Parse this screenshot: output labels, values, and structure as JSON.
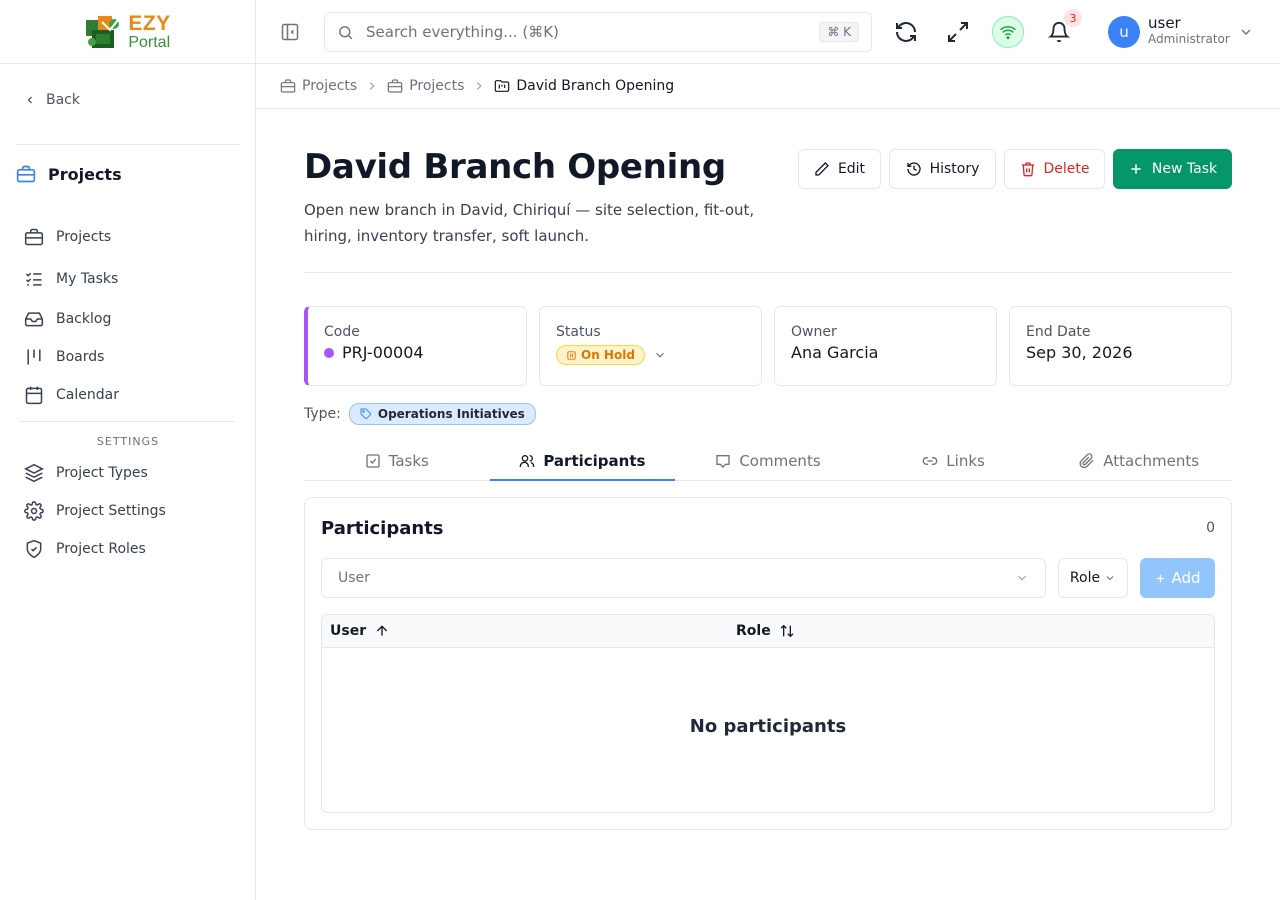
{
  "app": {
    "logo_line1": "EZY",
    "logo_line2": "Portal"
  },
  "sidebar": {
    "back_label": "Back",
    "section_title": "Projects",
    "items": [
      {
        "label": "Projects",
        "icon": "briefcase-icon"
      },
      {
        "label": "My Tasks",
        "icon": "list-checks-icon"
      },
      {
        "label": "Backlog",
        "icon": "inbox-icon"
      },
      {
        "label": "Boards",
        "icon": "kanban-icon"
      },
      {
        "label": "Calendar",
        "icon": "calendar-icon"
      }
    ],
    "settings_label": "SETTINGS",
    "settings_items": [
      {
        "label": "Project Types",
        "icon": "layers-icon"
      },
      {
        "label": "Project Settings",
        "icon": "gear-icon"
      },
      {
        "label": "Project Roles",
        "icon": "shield-icon"
      }
    ]
  },
  "header": {
    "search_placeholder": "Search everything... (⌘K)",
    "search_shortcut": "⌘ K",
    "notification_count": "3",
    "user_initial": "u",
    "user_name": "user",
    "user_role": "Administrator"
  },
  "breadcrumb": {
    "items": [
      "Projects",
      "Projects",
      "David Branch Opening"
    ]
  },
  "project": {
    "title": "David Branch Opening",
    "description": "Open new branch in David, Chiriquí — site selection, fit-out, hiring, inventory transfer, soft launch.",
    "actions": {
      "edit": "Edit",
      "history": "History",
      "delete": "Delete",
      "new_task": "New Task"
    },
    "cards": {
      "code_label": "Code",
      "code_value": "PRJ-00004",
      "status_label": "Status",
      "status_value": "On Hold",
      "owner_label": "Owner",
      "owner_value": "Ana Garcia",
      "end_label": "End Date",
      "end_value": "Sep 30, 2026"
    },
    "type_label": "Type:",
    "type_value": "Operations Initiatives"
  },
  "tabs": [
    {
      "label": "Tasks",
      "icon": "checkbox-icon"
    },
    {
      "label": "Participants",
      "icon": "users-icon"
    },
    {
      "label": "Comments",
      "icon": "comment-icon"
    },
    {
      "label": "Links",
      "icon": "link-icon"
    },
    {
      "label": "Attachments",
      "icon": "paperclip-icon"
    }
  ],
  "participants": {
    "title": "Participants",
    "count": "0",
    "user_placeholder": "User",
    "role_label": "Role",
    "add_label": "Add",
    "columns": [
      "User",
      "Role"
    ],
    "empty_text": "No participants"
  },
  "colors": {
    "primary": "#059669",
    "danger": "#dc2626",
    "accent_purple": "#a855f7",
    "tab_active": "#3b82f6"
  }
}
